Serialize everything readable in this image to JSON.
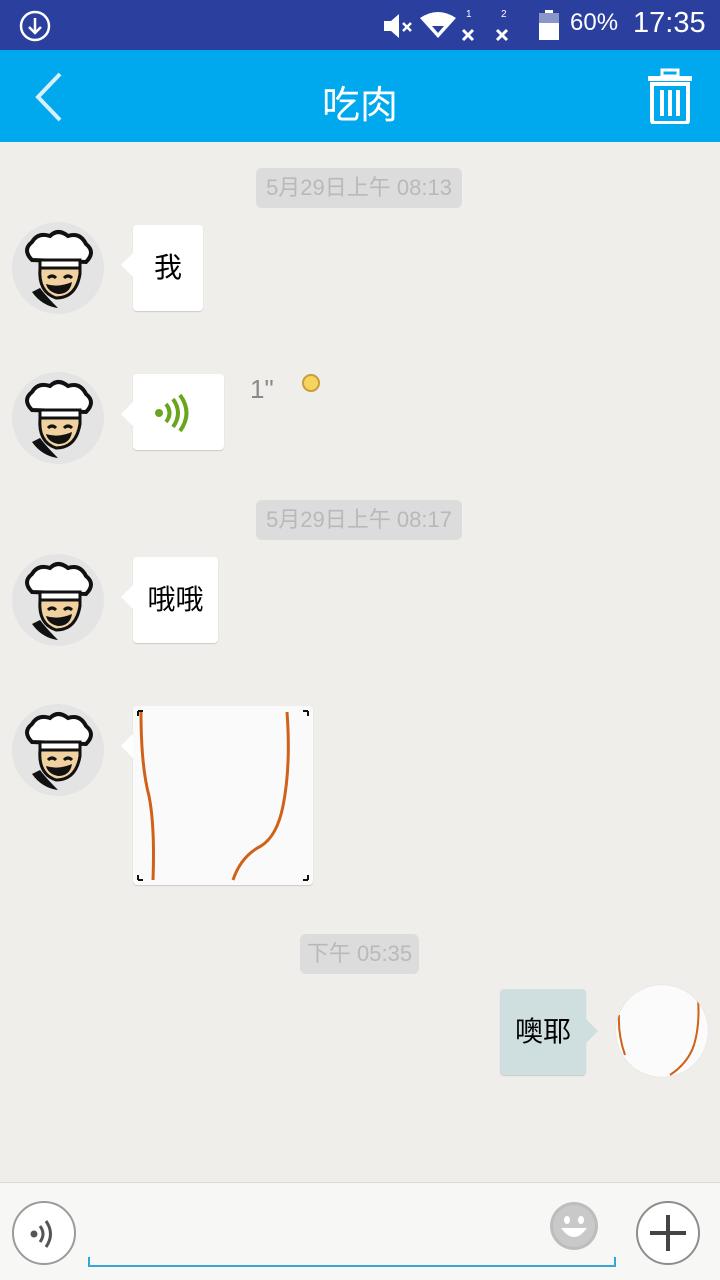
{
  "status_bar": {
    "battery": "60%",
    "time": "17:35",
    "sim1": "1",
    "sim2": "2"
  },
  "header": {
    "title": "吃肉"
  },
  "messages": [
    {
      "type": "timestamp",
      "text": "5月29日上午 08:13"
    },
    {
      "type": "text",
      "direction": "incoming",
      "text": "我"
    },
    {
      "type": "voice",
      "direction": "incoming",
      "duration": "1\"",
      "unread": true
    },
    {
      "type": "timestamp",
      "text": "5月29日上午 08:17"
    },
    {
      "type": "text",
      "direction": "incoming",
      "text": "哦哦"
    },
    {
      "type": "image",
      "direction": "incoming"
    },
    {
      "type": "timestamp",
      "text": "下午 05:35"
    },
    {
      "type": "text",
      "direction": "outgoing",
      "text": "噢耶"
    }
  ],
  "input": {
    "value": "",
    "placeholder": ""
  },
  "icons": {
    "download": "download-icon",
    "mute": "volume-mute-icon",
    "wifi": "wifi-icon",
    "battery": "battery-icon",
    "back": "chevron-left-icon",
    "trash": "trash-icon",
    "voice": "voice-wave-icon",
    "emoji": "smiley-icon",
    "plus": "plus-icon"
  },
  "colors": {
    "status_bar": "#2b3f9e",
    "header": "#00a8ee",
    "chat_bg": "#efeeea",
    "outgoing_bubble": "#cfdfe0",
    "input_underline": "#3aa4d8"
  }
}
